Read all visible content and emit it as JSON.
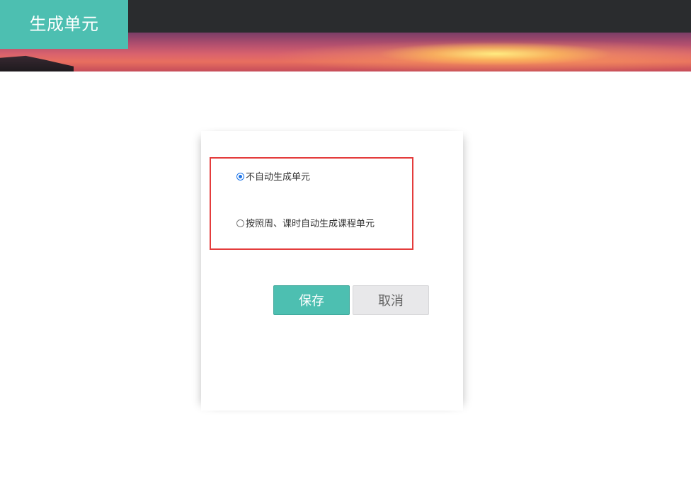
{
  "header": {
    "title": "生成单元"
  },
  "form": {
    "options": [
      {
        "label": "不自动生成单元",
        "checked": true
      },
      {
        "label": "按照周、课时自动生成课程单元",
        "checked": false
      }
    ],
    "save_label": "保存",
    "cancel_label": "取消"
  },
  "colors": {
    "accent": "#4dbfb1",
    "highlight_border": "#e43c3c",
    "header_bg": "#2a2c2e"
  }
}
